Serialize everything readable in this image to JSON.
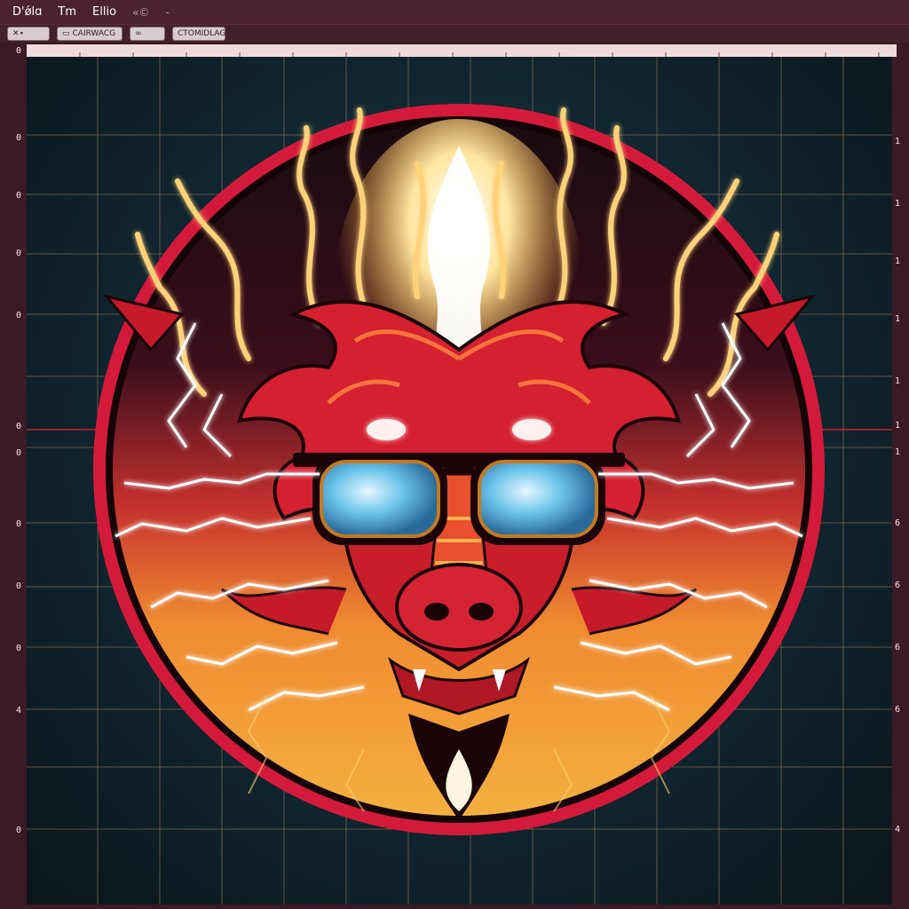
{
  "menubar": {
    "items": [
      "D'ǿlɑ",
      "Tm",
      "Ellio"
    ],
    "glyph": "«©",
    "sep": "-"
  },
  "toolbar": {
    "buttons": [
      {
        "icon": "close-x-icon",
        "label": "✕∙",
        "extra": ""
      },
      {
        "icon": "image-icon",
        "label": "▭",
        "extra": "CAIRWACG"
      },
      {
        "icon": "link-icon",
        "label": "∞",
        "extra": ""
      },
      {
        "icon": "grid-icon",
        "label": "",
        "extra": "CTOMIDLAG"
      }
    ]
  },
  "rulers": {
    "left_labels": [
      "0",
      "0",
      "0",
      "0",
      "0",
      "0",
      "0",
      "0",
      "0",
      "0",
      "4",
      "0"
    ],
    "right_labels": [
      "1",
      "1",
      "1",
      "1",
      "1",
      "1",
      "1",
      "6",
      "6",
      "6",
      "6",
      "4"
    ]
  },
  "artwork": {
    "name": "fire-dragon-with-sunglasses",
    "colors": {
      "ring": "#d41a3a",
      "circle_top": "#1a0a10",
      "circle_bottom": "#f0a030",
      "dragon": "#d42030",
      "lightning": "#ffffff",
      "lens": "#5ab8e0",
      "frame": "#c47a20"
    }
  }
}
